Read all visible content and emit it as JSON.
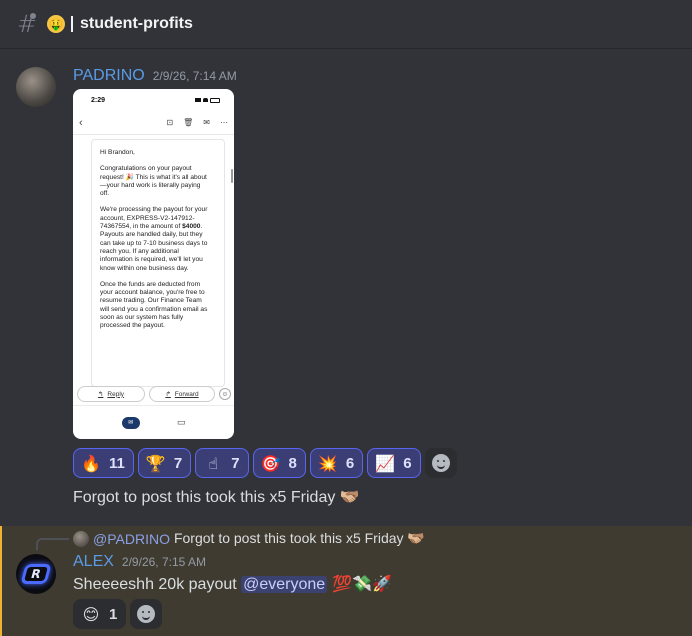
{
  "channel": {
    "emoji": "🤑",
    "name": "student-profits"
  },
  "messages": [
    {
      "author": "PADRINO",
      "timestamp": "2/9/26, 7:14 AM",
      "attachment": {
        "status_time": "2:29",
        "greeting": "Hi Brandon,",
        "p1": "Congratulations on your payout request! 🎉 This is what it's all about—your hard work is literally paying off.",
        "p2_a": "We're processing the payout for your account, EXPRESS-V2-147912-74367554, in the amount of ",
        "p2_amount": "$4000",
        "p2_b": ". Payouts are handled daily, but they can take up to 7-10 business days to reach you. If any additional information is required, we'll let you know within one business day.",
        "p3": "Once the funds are deducted from your account balance, you're free to resume trading. Our Finance Team will send you a confirmation email as soon as our system has fully processed the payout.",
        "reply_label": "Reply",
        "forward_label": "Forward"
      },
      "reactions": [
        {
          "emoji": "🔥",
          "count": "11"
        },
        {
          "emoji": "🏆",
          "count": "7"
        },
        {
          "emoji": "☝",
          "count": "7"
        },
        {
          "emoji": "🎯",
          "count": "8"
        },
        {
          "emoji": "💥",
          "count": "6"
        },
        {
          "emoji": "📈",
          "count": "6"
        }
      ],
      "text": "Forgot to post this took this x5 Friday 🫱🏼‍🫲🏽"
    },
    {
      "author": "ALEX",
      "timestamp": "2/9/26, 7:15 AM",
      "reply_to": {
        "mention": "@PADRINO",
        "text": "Forgot to post this took this x5 Friday 🫱🏼‍🫲🏽"
      },
      "text_before": "Sheeeeshh 20k payout ",
      "mention": "@everyone",
      "emojis_after": " 💯💸🚀",
      "reactions": [
        {
          "emoji": "😊",
          "count": "1"
        }
      ]
    }
  ],
  "colors": {
    "background": "#313338",
    "username": "#5a9be6",
    "reaction_active_bg": "#3b3e74",
    "reaction_active_border": "#5865f2",
    "highlight_bg": "#3f3b30",
    "highlight_border": "#f0b232"
  }
}
